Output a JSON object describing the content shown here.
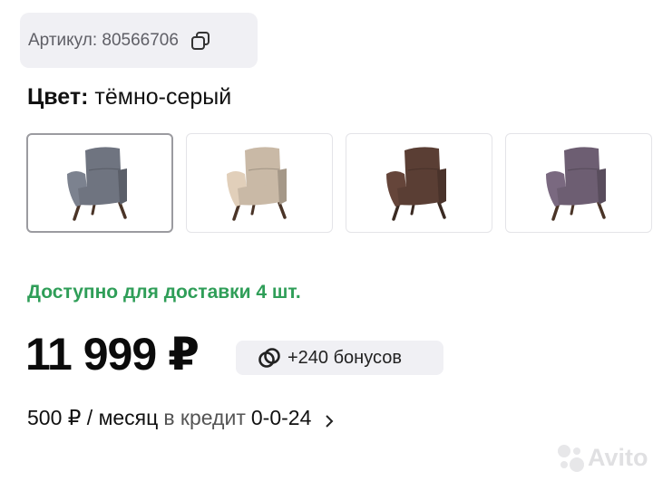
{
  "sku": {
    "label": "Артикул: 80566706",
    "icon": "copy-icon"
  },
  "color": {
    "label": "Цвет:",
    "value": "тёмно-серый"
  },
  "swatches": [
    {
      "color": "#6f7480",
      "leg": "#4a3427",
      "selected": true
    },
    {
      "color": "#c9b9a6",
      "leg": "#4a3427",
      "selected": false
    },
    {
      "color": "#5a3e34",
      "leg": "#3a2a22",
      "selected": false
    },
    {
      "color": "#6d5e72",
      "leg": "#4a3427",
      "selected": false
    }
  ],
  "availability": "Доступно для доставки 4 шт.",
  "price": "11 999 ₽",
  "bonus": {
    "text": "+240 бонусов",
    "icon": "bonus-icon"
  },
  "credit": {
    "amount": "500 ₽ / месяц",
    "middle": "в кредит",
    "plan": "0-0-24"
  },
  "watermark": "Avito",
  "colors": {
    "accent_green": "#2f9e58",
    "chip_bg": "#f0f0f4"
  }
}
